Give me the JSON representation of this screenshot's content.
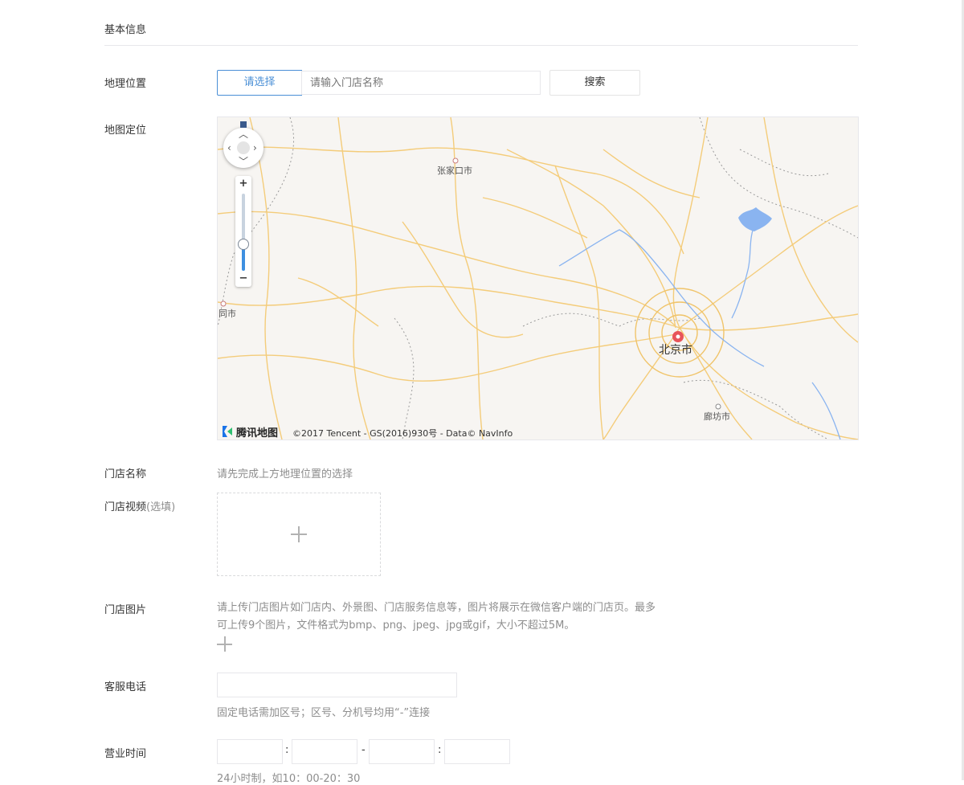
{
  "section": {
    "title": "基本信息"
  },
  "location": {
    "label": "地理位置",
    "select_button": "请选择",
    "store_name_placeholder": "请输入门店名称",
    "search_button": "搜索"
  },
  "map": {
    "label": "地图定位",
    "place_labels": {
      "zhangjiakou": "张家口市",
      "datong": "同市",
      "beijing": "北京市",
      "langfang": "廊坊市"
    },
    "logo_text": "腾讯地图",
    "copyright": "©2017 Tencent - GS(2016)930号 - Data© NavInfo",
    "zoom_in": "+",
    "zoom_out": "−",
    "zoom_level_fraction": 0.35
  },
  "store_name": {
    "label": "门店名称",
    "hint": "请先完成上方地理位置的选择"
  },
  "store_video": {
    "label": "门店视频",
    "optional": "(选填)"
  },
  "store_images": {
    "label": "门店图片",
    "desc_line1": "请上传门店图片如门店内、外景图、门店服务信息等，图片将展示在微信客户端的门店页。最多",
    "desc_line2": "可上传9个图片，文件格式为bmp、png、jpeg、jpg或gif，大小不超过5M。"
  },
  "phone": {
    "label": "客服电话",
    "hint": "固定电话需加区号；区号、分机号均用“-”连接"
  },
  "hours": {
    "label": "营业时间",
    "sep_colon": ":",
    "sep_dash": "-",
    "hint": "24小时制，如10：00-20：30"
  },
  "colors": {
    "accent": "#4a8fd6",
    "road": "#f7d58a",
    "water": "#8ab4f0",
    "capital_marker": "#e8545a"
  }
}
